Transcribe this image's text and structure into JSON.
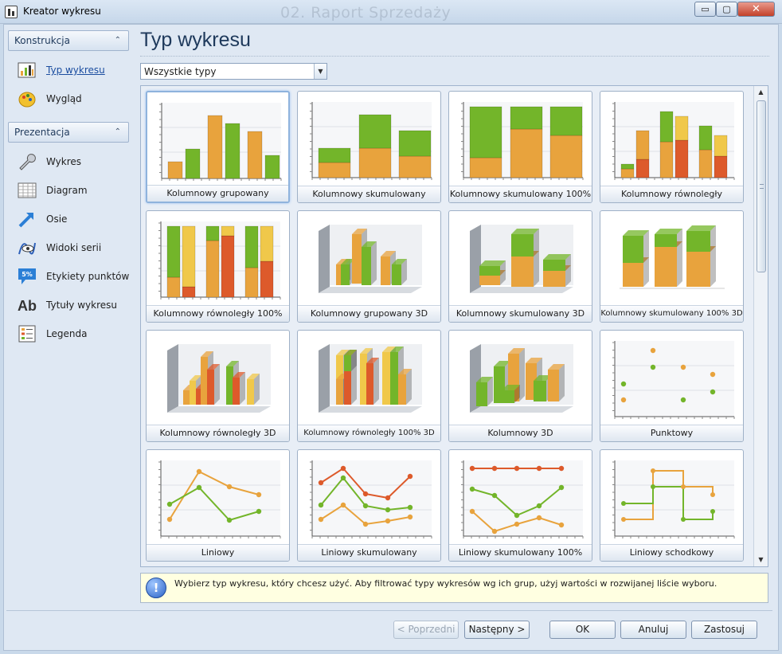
{
  "window": {
    "title": "Kreator wykresu",
    "document_title": "02. Raport Sprzedaży",
    "min_glyph": "▭",
    "max_glyph": "▢",
    "close_glyph": "✕"
  },
  "sidebar": {
    "groups": [
      {
        "title": "Konstrukcja",
        "items": [
          {
            "label": "Typ wykresu",
            "icon": "chart-type-icon",
            "active": true
          },
          {
            "label": "Wygląd",
            "icon": "palette-icon"
          }
        ]
      },
      {
        "title": "Prezentacja",
        "items": [
          {
            "label": "Wykres",
            "icon": "wrench-icon"
          },
          {
            "label": "Diagram",
            "icon": "grid-icon"
          },
          {
            "label": "Osie",
            "icon": "axis-arrow-icon"
          },
          {
            "label": "Widoki serii",
            "icon": "series-view-icon"
          },
          {
            "label": "Etykiety punktów",
            "icon": "point-label-icon",
            "icon_text": "5%"
          },
          {
            "label": "Tytuły wykresu",
            "icon": "title-ab-icon",
            "icon_text": "Ab"
          },
          {
            "label": "Legenda",
            "icon": "legend-icon"
          }
        ]
      }
    ],
    "collapse_glyph": "⌃"
  },
  "main": {
    "title": "Typ wykresu",
    "filter": {
      "value": "Wszystkie typy",
      "arrow": "▼"
    },
    "chart_types": [
      "Kolumnowy grupowany",
      "Kolumnowy skumulowany",
      "Kolumnowy skumulowany 100%",
      "Kolumnowy równoległy",
      "Kolumnowy równoległy 100%",
      "Kolumnowy grupowany 3D",
      "Kolumnowy skumulowany 3D",
      "Kolumnowy skumulowany 100% 3D",
      "Kolumnowy równoległy 3D",
      "Kolumnowy równoległy 100% 3D",
      "Kolumnowy 3D",
      "Punktowy",
      "Liniowy",
      "Liniowy skumulowany",
      "Liniowy skumulowany 100%",
      "Liniowy schodkowy"
    ],
    "selected_index": 0,
    "scroll": {
      "up": "▲",
      "down": "▼"
    },
    "hint": "Wybierz typ wykresu, który chcesz użyć. Aby filtrować typy wykresów wg ich grup, użyj wartości w rozwijanej liście wyboru.",
    "hint_icon": "!"
  },
  "buttons": {
    "prev": "< Poprzedni",
    "next": "Następny >",
    "ok": "OK",
    "cancel": "Anuluj",
    "apply": "Zastosuj"
  },
  "colors": {
    "green": "#73b52a",
    "orange": "#e8a33d",
    "red": "#dd5a2b",
    "yellow": "#f0c84a",
    "accent": "#1e395b"
  }
}
